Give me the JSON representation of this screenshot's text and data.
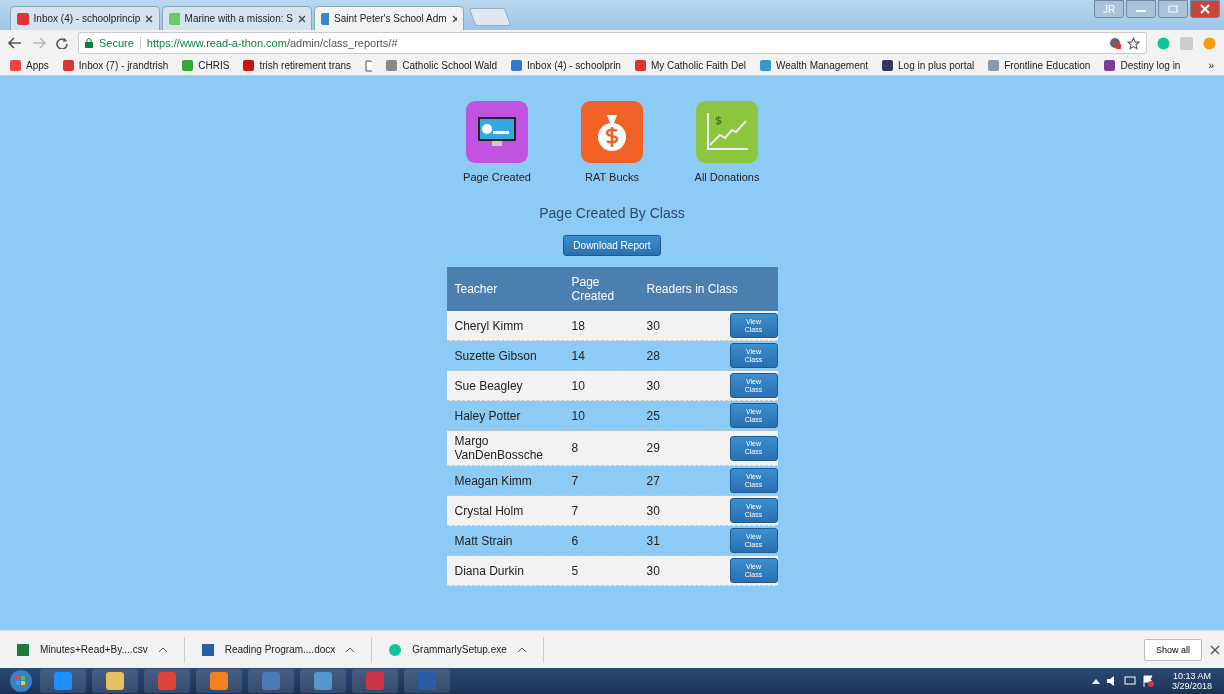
{
  "browser": {
    "tabs": [
      {
        "title": "Inbox (4) - schoolprincip",
        "selected": false
      },
      {
        "title": "Marine with a mission: S",
        "selected": false
      },
      {
        "title": "Saint Peter's School Adm",
        "selected": true
      }
    ],
    "profile": "JR",
    "address": {
      "security": "Secure",
      "host": "https://www.read-a-thon.com",
      "path": "/admin/class_reports/#"
    },
    "bookmarks": [
      {
        "label": "Apps"
      },
      {
        "label": "Inbox (7) - jrandtrish"
      },
      {
        "label": "CHRIS"
      },
      {
        "label": "trish retirement trans"
      },
      {
        "label": "Catholic School Wald"
      },
      {
        "label": "Inbox (4) - schoolprin"
      },
      {
        "label": "My Catholic Faith Del"
      },
      {
        "label": "Wealth Management"
      },
      {
        "label": "Log in plus portal"
      },
      {
        "label": "Frontline Education"
      },
      {
        "label": "Destiny log in"
      }
    ],
    "more": "»"
  },
  "page": {
    "tiles": [
      {
        "label": "Page Created",
        "kind": "monitor"
      },
      {
        "label": "RAT Bucks",
        "kind": "moneybag"
      },
      {
        "label": "All Donations",
        "kind": "chart"
      }
    ],
    "heading": "Page Created By Class",
    "download_button": "Download Report",
    "table": {
      "columns": [
        "Teacher",
        "Page Created",
        "Readers in Class"
      ],
      "rows": [
        {
          "teacher": "Cheryl Kimm",
          "pages": "18",
          "readers": "30",
          "action": "View Class"
        },
        {
          "teacher": "Suzette Gibson",
          "pages": "14",
          "readers": "28",
          "action": "View Class"
        },
        {
          "teacher": "Sue Beagley",
          "pages": "10",
          "readers": "30",
          "action": "View Class"
        },
        {
          "teacher": "Haley Potter",
          "pages": "10",
          "readers": "25",
          "action": "View Class"
        },
        {
          "teacher": "Margo VanDenBossche",
          "pages": "8",
          "readers": "29",
          "action": "View Class"
        },
        {
          "teacher": "Meagan Kimm",
          "pages": "7",
          "readers": "27",
          "action": "View Class"
        },
        {
          "teacher": "Crystal Holm",
          "pages": "7",
          "readers": "30",
          "action": "View Class"
        },
        {
          "teacher": "Matt Strain",
          "pages": "6",
          "readers": "31",
          "action": "View Class"
        },
        {
          "teacher": "Diana Durkin",
          "pages": "5",
          "readers": "30",
          "action": "View Class"
        }
      ]
    }
  },
  "downloads": {
    "items": [
      {
        "name": "Minutes+Read+By....csv",
        "kind": "excel"
      },
      {
        "name": "Reading Program....docx",
        "kind": "word"
      },
      {
        "name": "GrammarlySetup.exe",
        "kind": "grammarly"
      }
    ],
    "show_all": "Show all"
  },
  "taskbar": {
    "time": "10:13 AM",
    "date": "3/29/2018"
  }
}
